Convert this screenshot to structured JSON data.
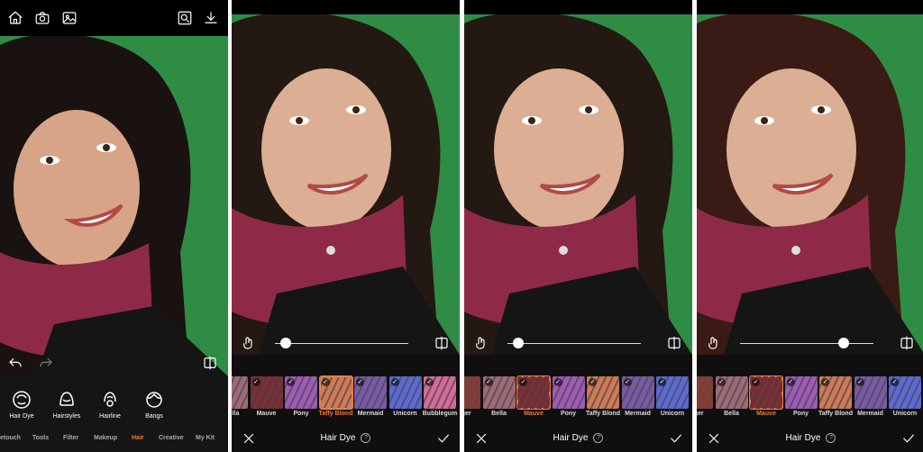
{
  "panel1": {
    "tools": [
      {
        "label": "Hair Dye",
        "icon": "hair-dye-icon"
      },
      {
        "label": "Hairstyles",
        "icon": "hairstyles-icon"
      },
      {
        "label": "Hairline",
        "icon": "hairline-icon"
      },
      {
        "label": "Bangs",
        "icon": "bangs-icon"
      }
    ],
    "categories": [
      "etouch",
      "Tools",
      "Filter",
      "Makeup",
      "Hair",
      "Creative",
      "My Kit"
    ],
    "active_category": "Hair"
  },
  "panel2": {
    "swatches": [
      {
        "label": "Bella",
        "color": "#a06a78"
      },
      {
        "label": "Mauve",
        "color": "#7a2a32"
      },
      {
        "label": "Pony",
        "color": "#a05ab8"
      },
      {
        "label": "Taffy Blond",
        "color": "#d27a55"
      },
      {
        "label": "Mermaid",
        "color": "#7a5aa8"
      },
      {
        "label": "Unicorn",
        "color": "#5a6ad8"
      },
      {
        "label": "Bubblegum",
        "color": "#d86a9a"
      }
    ],
    "selected": "Taffy Blond",
    "slider": 0.08,
    "title": "Hair Dye"
  },
  "panel3": {
    "swatches": [
      {
        "label": "nger",
        "color": "#8a3a32"
      },
      {
        "label": "Bella",
        "color": "#a06a78"
      },
      {
        "label": "Mauve",
        "color": "#7a2a32"
      },
      {
        "label": "Pony",
        "color": "#a05ab8"
      },
      {
        "label": "Taffy Blond",
        "color": "#d27a55"
      },
      {
        "label": "Mermaid",
        "color": "#7a5aa8"
      },
      {
        "label": "Unicorn",
        "color": "#5a6ad8"
      }
    ],
    "selected": "Mauve",
    "slider": 0.08,
    "title": "Hair Dye"
  },
  "panel4": {
    "swatches": [
      {
        "label": "nger",
        "color": "#8a3a32"
      },
      {
        "label": "Bella",
        "color": "#a06a78"
      },
      {
        "label": "Mauve",
        "color": "#7a2a32"
      },
      {
        "label": "Pony",
        "color": "#a05ab8"
      },
      {
        "label": "Taffy Blond",
        "color": "#d27a55"
      },
      {
        "label": "Mermaid",
        "color": "#7a5aa8"
      },
      {
        "label": "Unicorn",
        "color": "#5a6ad8"
      }
    ],
    "selected": "Mauve",
    "slider": 0.78,
    "title": "Hair Dye"
  },
  "colors": {
    "accent": "#f07b34",
    "background": "#2f8c45"
  }
}
